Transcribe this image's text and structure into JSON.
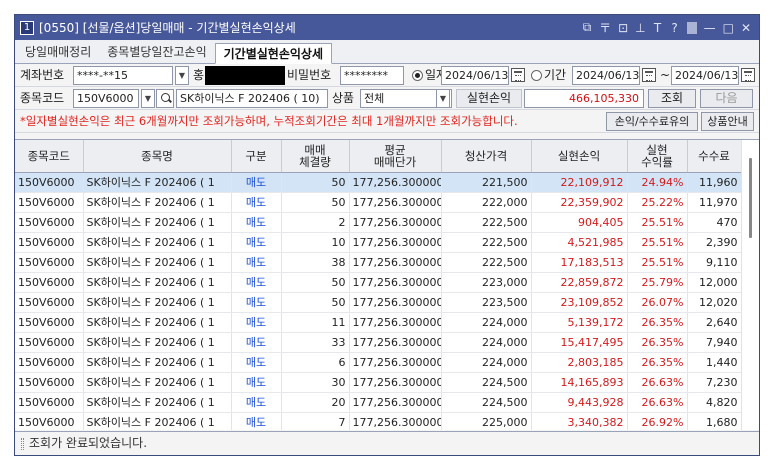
{
  "window": {
    "number": "1",
    "title": "[0550] [선물/옵션]당일매매 - 기간별실현손익상세",
    "icons": [
      "link-icon",
      "pin-icon",
      "copy-icon",
      "pushpin-icon",
      "font-size-icon",
      "help-icon",
      "minimize-icon",
      "maximize-icon",
      "close-icon"
    ],
    "icon_glyphs": {
      "link": "⧉",
      "pin": "〒",
      "copy": "⊡",
      "pushpin": "⊥",
      "font": "T",
      "help": "?",
      "minimize": "—",
      "maximize": "□",
      "close": "✕"
    }
  },
  "tabs": [
    {
      "label": "당일매매정리"
    },
    {
      "label": "종목별당일잔고손익"
    },
    {
      "label": "기간별실현손익상세"
    }
  ],
  "form": {
    "account_label": "계좌번호",
    "account_value": "****-**15",
    "account_name_label": "홍",
    "password_label": "비밀번호",
    "password_value": "********",
    "radio_date_label": "일자",
    "date_value": "2024/06/13",
    "radio_period_label": "기간",
    "period_from": "2024/06/13",
    "period_sep": "~",
    "period_to": "2024/06/13",
    "code_label": "종목코드",
    "code_value": "150V6000",
    "item_name_value": "SK하이닉스 F 202406 ( 10)",
    "product_label": "상품",
    "product_value": "전체",
    "pnl_label": "실현손익",
    "pnl_value": "466,105,330",
    "query_button": "조회",
    "next_button": "다음",
    "notice": "*일자별실현손익은 최근 6개월까지만 조회가능하며, 누적조회기간은 최대 1개월까지만 조회가능합니다.",
    "fee_button": "손익/수수료유의",
    "product_info_button": "상품안내"
  },
  "table": {
    "headers": [
      "종목코드",
      "종목명",
      "구분",
      "매매\n체결량",
      "평균\n매매단가",
      "청산가격",
      "실현손익",
      "실현\n수익률",
      "수수료"
    ],
    "rows": [
      [
        "150V6000",
        "SK하이닉스 F 202406 ( 1",
        "매도",
        "50",
        "177,256.300000",
        "221,500",
        "22,109,912",
        "24.94%",
        "11,960"
      ],
      [
        "150V6000",
        "SK하이닉스 F 202406 ( 1",
        "매도",
        "50",
        "177,256.300000",
        "222,000",
        "22,359,902",
        "25.22%",
        "11,970"
      ],
      [
        "150V6000",
        "SK하이닉스 F 202406 ( 1",
        "매도",
        "2",
        "177,256.300000",
        "222,500",
        "904,405",
        "25.51%",
        "470"
      ],
      [
        "150V6000",
        "SK하이닉스 F 202406 ( 1",
        "매도",
        "10",
        "177,256.300000",
        "222,500",
        "4,521,985",
        "25.51%",
        "2,390"
      ],
      [
        "150V6000",
        "SK하이닉스 F 202406 ( 1",
        "매도",
        "38",
        "177,256.300000",
        "222,500",
        "17,183,513",
        "25.51%",
        "9,110"
      ],
      [
        "150V6000",
        "SK하이닉스 F 202406 ( 1",
        "매도",
        "50",
        "177,256.300000",
        "223,000",
        "22,859,872",
        "25.79%",
        "12,000"
      ],
      [
        "150V6000",
        "SK하이닉스 F 202406 ( 1",
        "매도",
        "50",
        "177,256.300000",
        "223,500",
        "23,109,852",
        "26.07%",
        "12,020"
      ],
      [
        "150V6000",
        "SK하이닉스 F 202406 ( 1",
        "매도",
        "11",
        "177,256.300000",
        "224,000",
        "5,139,172",
        "26.35%",
        "2,640"
      ],
      [
        "150V6000",
        "SK하이닉스 F 202406 ( 1",
        "매도",
        "33",
        "177,256.300000",
        "224,000",
        "15,417,495",
        "26.35%",
        "7,940"
      ],
      [
        "150V6000",
        "SK하이닉스 F 202406 ( 1",
        "매도",
        "6",
        "177,256.300000",
        "224,000",
        "2,803,185",
        "26.35%",
        "1,440"
      ],
      [
        "150V6000",
        "SK하이닉스 F 202406 ( 1",
        "매도",
        "30",
        "177,256.300000",
        "224,500",
        "14,165,893",
        "26.63%",
        "7,230"
      ],
      [
        "150V6000",
        "SK하이닉스 F 202406 ( 1",
        "매도",
        "20",
        "177,256.300000",
        "224,500",
        "9,443,928",
        "26.63%",
        "4,820"
      ],
      [
        "150V6000",
        "SK하이닉스 F 202406 ( 1",
        "매도",
        "7",
        "177,256.300000",
        "225,000",
        "3,340,382",
        "26.92%",
        "1,680"
      ]
    ],
    "selected_row": 0
  },
  "status": {
    "message": "조회가 완료되었습니다."
  },
  "colors": {
    "titlebar": "#46589a",
    "sell": "#1b4fd8",
    "profit": "#d21a1a",
    "selected_row": "#d2e4f6",
    "notice": "#e0241c"
  }
}
